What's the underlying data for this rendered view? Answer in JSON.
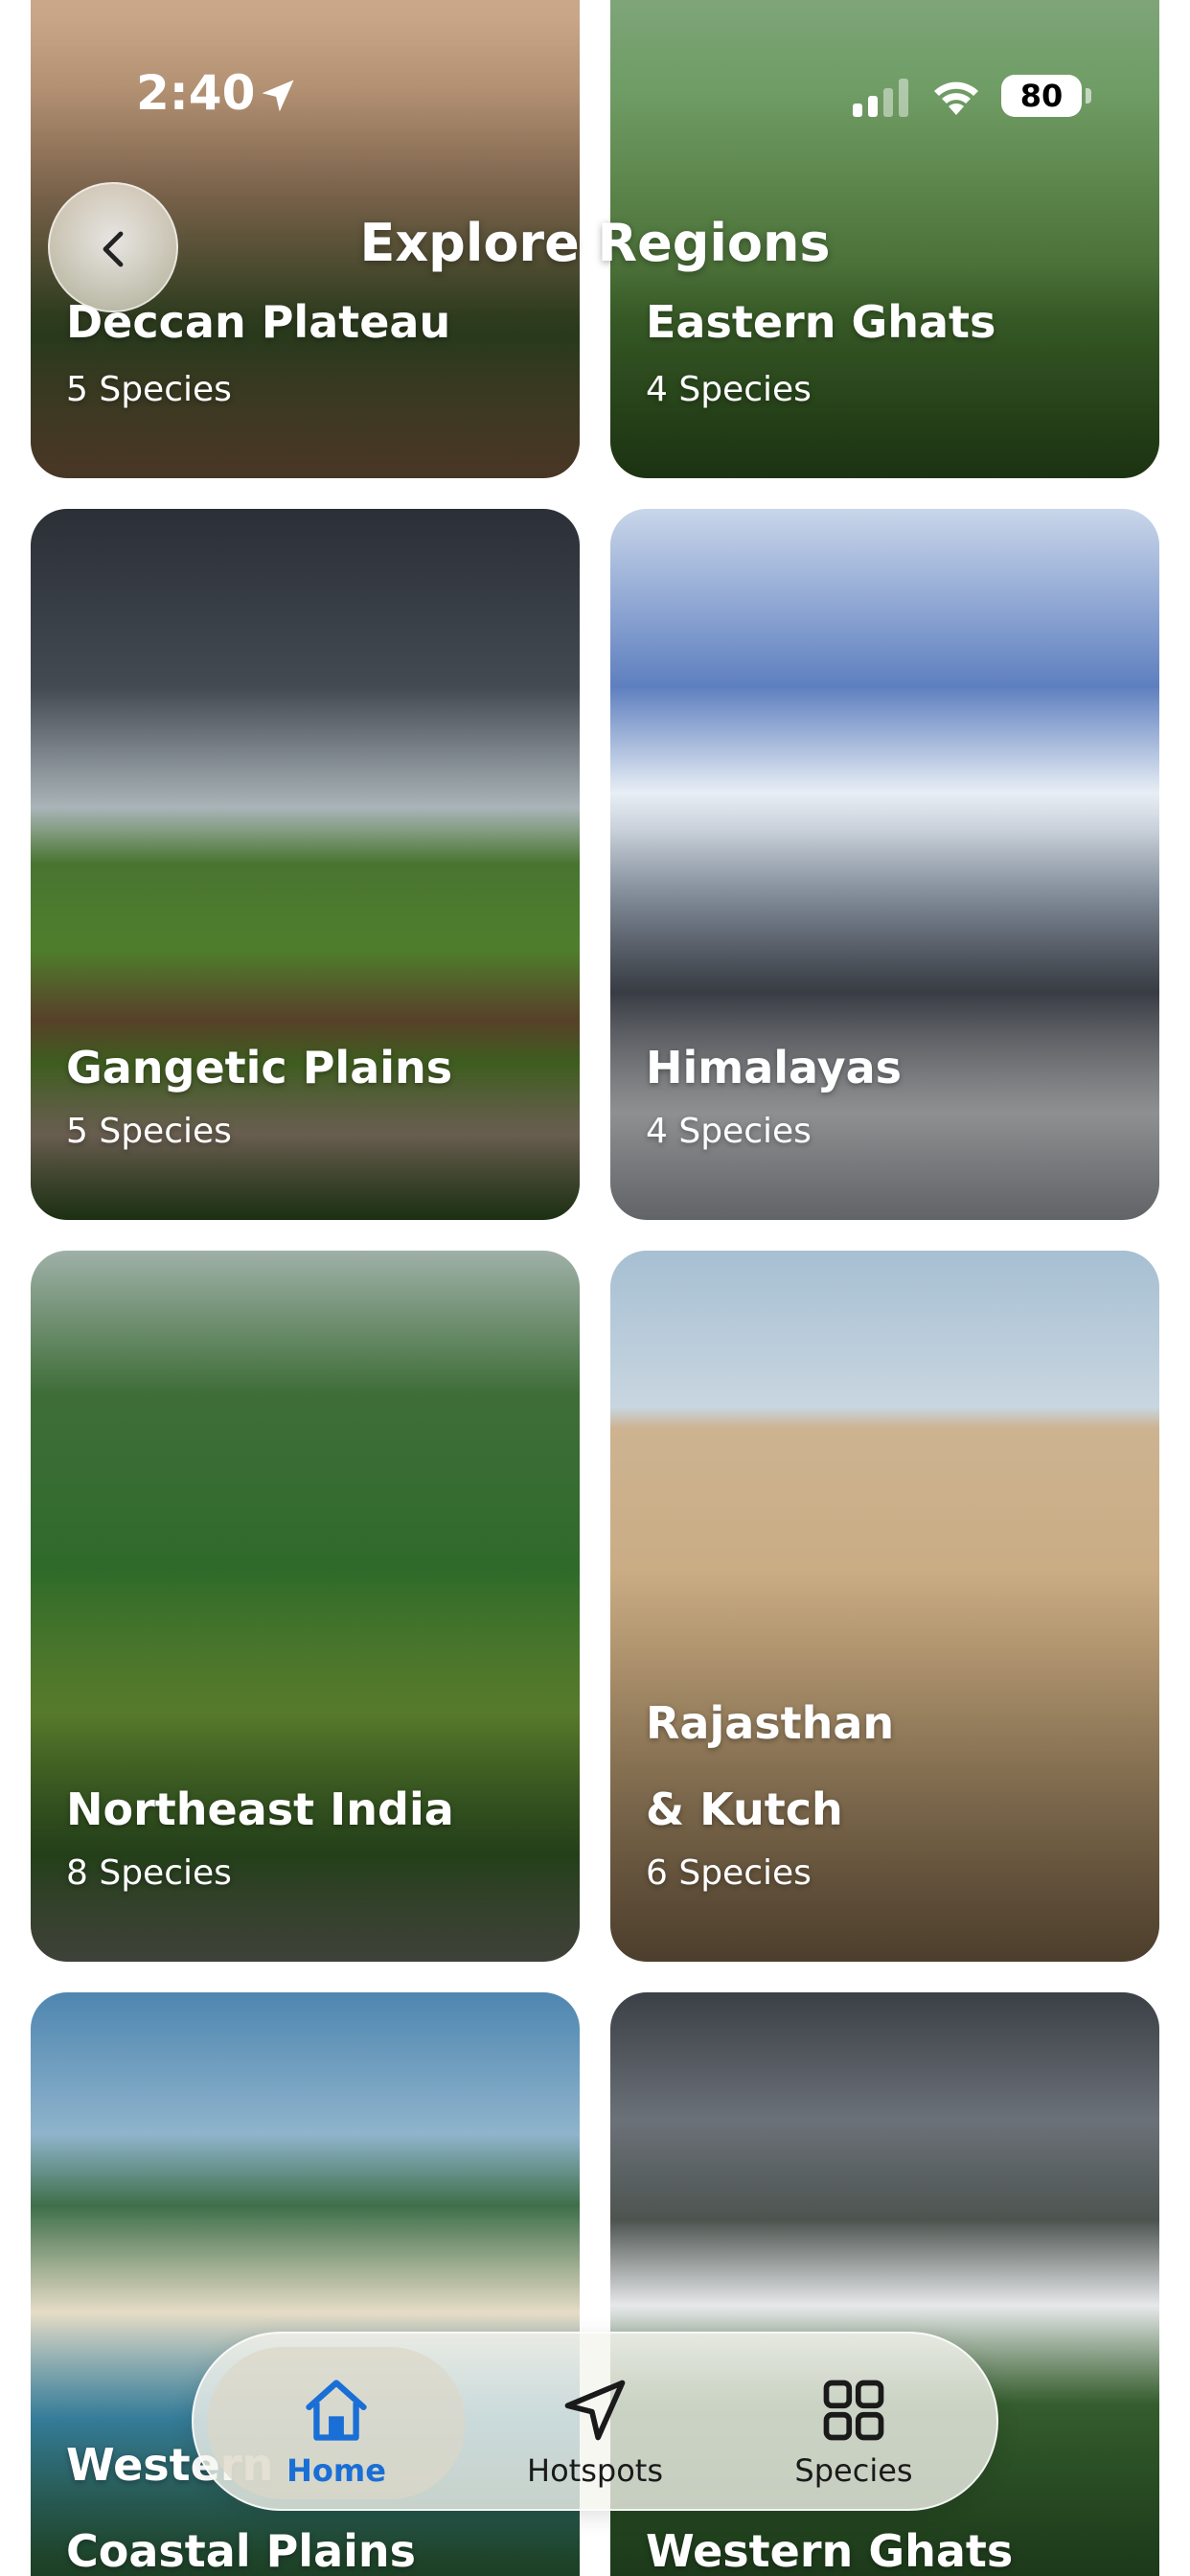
{
  "status_bar": {
    "time": "2:40",
    "battery": "80",
    "icons": [
      "location-arrow-icon",
      "cellular-signal-icon",
      "wifi-icon",
      "battery-icon"
    ]
  },
  "header": {
    "title": "Explore Regions",
    "back_icon": "chevron-left-icon"
  },
  "regions": [
    {
      "name": "Deccan Plateau",
      "count": "5 Species"
    },
    {
      "name": "Eastern Ghats",
      "count": "4 Species"
    },
    {
      "name": "Gangetic Plains",
      "count": "5 Species"
    },
    {
      "name": "Himalayas",
      "count": "4 Species"
    },
    {
      "name": "Northeast India",
      "count": "8 Species"
    },
    {
      "name": "Rajasthan\n& Kutch",
      "count": "6 Species"
    },
    {
      "name": "Western\nCoastal Plains",
      "count": ""
    },
    {
      "name": "Western Ghats",
      "count": ""
    }
  ],
  "tabbar": {
    "tabs": [
      {
        "label": "Home",
        "icon": "home-icon",
        "active": true
      },
      {
        "label": "Hotspots",
        "icon": "navigation-arrow-icon",
        "active": false
      },
      {
        "label": "Species",
        "icon": "grid-icon",
        "active": false
      }
    ],
    "active_color": "#1a6fd6"
  }
}
